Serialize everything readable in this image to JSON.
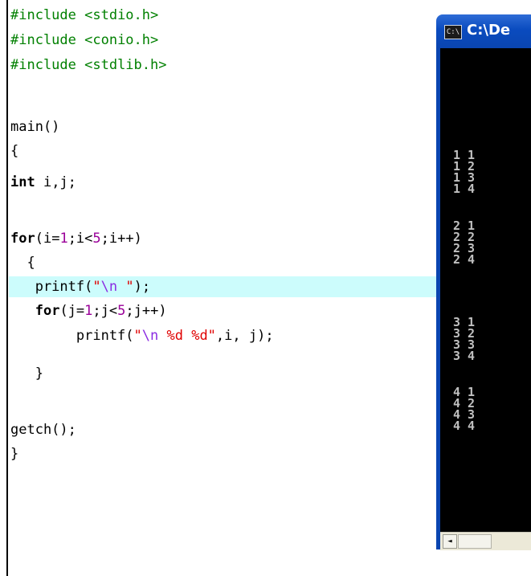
{
  "editor": {
    "lines": {
      "l1": {
        "kw": "#include",
        "rest": " <stdio.h>"
      },
      "l2": {
        "kw": "#include",
        "rest": " <conio.h>"
      },
      "l3": {
        "kw": "#include",
        "rest": " <stdlib.h>"
      },
      "l5": "main()",
      "l6": "{",
      "l7": {
        "kw": "int",
        "rest": " i,j;"
      },
      "l9": {
        "kw": "for",
        "a": "(i=",
        "n1": "1",
        "b": ";i<",
        "n2": "5",
        "c": ";i++)"
      },
      "l10": "  {",
      "l11": {
        "a": "   printf(",
        "q1": "\"",
        "esc": "\\n",
        "q2": " \"",
        "b": ");"
      },
      "l12": {
        "pre": "   ",
        "kw": "for",
        "a": "(j=",
        "n1": "1",
        "b": ";j<",
        "n2": "5",
        "c": ";j++)"
      },
      "l13": {
        "a": "        printf(",
        "q1": "\"",
        "esc": "\\n",
        "s": " %d %d\"",
        "b": ",i, j);"
      },
      "l14": "   }",
      "l16": "getch();",
      "l17": "}"
    }
  },
  "console": {
    "title": "C:\\De",
    "icon": "console-icon",
    "output": [
      "1 1",
      "1 2",
      "1 3",
      "1 4",
      "2 1",
      "2 2",
      "2 3",
      "2 4",
      "3 1",
      "3 2",
      "3 3",
      "3 4",
      "4 1",
      "4 2",
      "4 3",
      "4 4"
    ],
    "scroll_left_icon": "◄"
  },
  "colors": {
    "preprocessor": "#008000",
    "number": "#9a0099",
    "string": "#e00000",
    "highlight": "#ccfcfc",
    "console_bg": "#000000",
    "titlebar": "#0a4bbf"
  }
}
